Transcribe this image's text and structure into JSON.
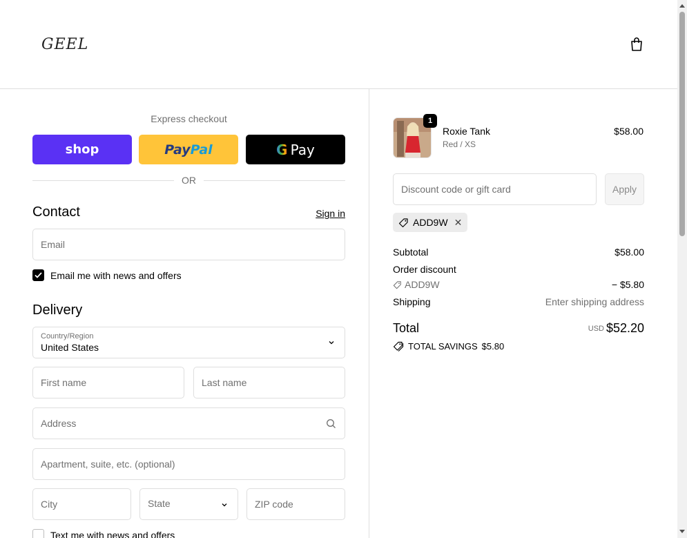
{
  "header": {
    "logo_text": "GEEL",
    "cart_icon": "shopping-bag-icon"
  },
  "express": {
    "label": "Express checkout",
    "shop_label": "shop",
    "paypal_label_1": "Pay",
    "paypal_label_2": "Pal",
    "gpay_g": "G",
    "gpay_label": "Pay",
    "or_label": "OR"
  },
  "contact": {
    "title": "Contact",
    "sign_in": "Sign in",
    "email_placeholder": "Email",
    "news_label": "Email me with news and offers",
    "news_checked": true
  },
  "delivery": {
    "title": "Delivery",
    "country_label": "Country/Region",
    "country_value": "United States",
    "first_name_placeholder": "First name",
    "last_name_placeholder": "Last name",
    "address_placeholder": "Address",
    "apartment_placeholder": "Apartment, suite, etc. (optional)",
    "city_placeholder": "City",
    "state_placeholder": "State",
    "zip_placeholder": "ZIP code",
    "text_label": "Text me with news and offers",
    "text_checked": false
  },
  "order": {
    "item": {
      "name": "Roxie Tank",
      "variant": "Red / XS",
      "price": "$58.00",
      "quantity": "1"
    },
    "discount_placeholder": "Discount code or gift card",
    "apply_label": "Apply",
    "applied_code": "ADD9W",
    "subtotal_label": "Subtotal",
    "subtotal_value": "$58.00",
    "order_discount_label": "Order discount",
    "discount_code": "ADD9W",
    "discount_value": "− $5.80",
    "shipping_label": "Shipping",
    "shipping_value": "Enter shipping address",
    "total_label": "Total",
    "currency": "USD",
    "total_value": "$52.20",
    "savings_label": "TOTAL SAVINGS",
    "savings_value": "$5.80"
  },
  "colors": {
    "shop_pay": "#5a31f4",
    "paypal": "#ffc439",
    "gpay": "#000000",
    "border": "#dedede",
    "muted_text": "#707070"
  }
}
